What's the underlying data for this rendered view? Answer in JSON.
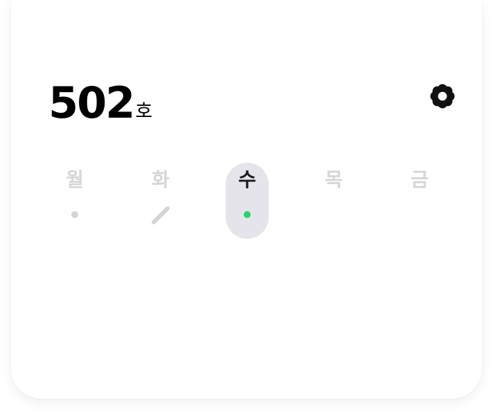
{
  "room": {
    "number": "502",
    "suffix": "호"
  },
  "settings_icon": "gear-icon",
  "days": [
    {
      "label": "월",
      "selected": false,
      "status": "dot",
      "status_color": "#d4d4d4"
    },
    {
      "label": "화",
      "selected": false,
      "status": "pencil-icon",
      "status_color": "#d4d4d4"
    },
    {
      "label": "수",
      "selected": true,
      "status": "dot",
      "status_color": "#22d66b"
    },
    {
      "label": "목",
      "selected": false,
      "status": "none"
    },
    {
      "label": "금",
      "selected": false,
      "status": "none"
    }
  ],
  "colors": {
    "selected_bg": "#e4e4ea",
    "inactive_text": "#d6d6d6",
    "active_text": "#1c1c1c",
    "active_dot": "#22d66b"
  }
}
